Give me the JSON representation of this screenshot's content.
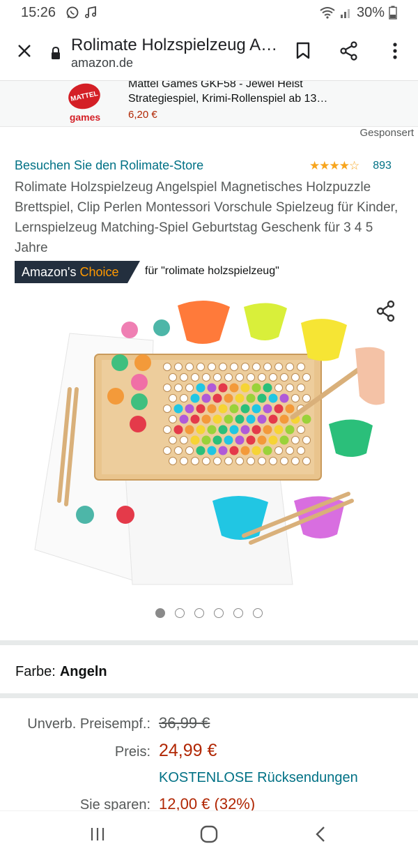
{
  "status_bar": {
    "time": "15:26",
    "battery": "30%",
    "icons": [
      "whatsapp-icon",
      "music-note-icon",
      "wifi-icon",
      "signal-icon",
      "battery-icon"
    ]
  },
  "browser": {
    "title": "Rolimate Holzspielzeug Angelspiel Magnetisches Holzpuzzle",
    "url": "amazon.de",
    "icons": [
      "close-icon",
      "lock-icon",
      "bookmark-icon",
      "share-icon",
      "more-vert-icon"
    ]
  },
  "sponsored_ad": {
    "logo_top": "MATTEL",
    "logo_bottom": "games",
    "line1": "Mattel Games GKF58 - Jewel Heist",
    "line2": "Strategiespiel, Krimi-Rollenspiel ab 13…",
    "price": "6,20 €",
    "sponsored_label": "Gesponsert"
  },
  "product": {
    "store_link": "Besuchen Sie den Rolimate-Store",
    "rating": 4.5,
    "rating_count": "893",
    "title": "Rolimate Holzspielzeug Angelspiel Magnetisches Holzpuzzle Brettspiel, Clip Perlen Montessori Vorschule Spielzeug für Kinder, Lernspielzeug Matching-Spiel Geburtstag Geschenk für 3 4 5 Jahre",
    "choice_badge_prefix": "Amazon's",
    "choice_badge_word": "Choice",
    "choice_for": "für \"rolimate holzspielzeug\"",
    "image_count": 6,
    "image_active_index": 0
  },
  "variation": {
    "label": "Farbe:",
    "value": "Angeln"
  },
  "pricing": {
    "list_price_label": "Unverb. Preisempf.:",
    "list_price": "36,99 €",
    "price_label": "Preis:",
    "price": "24,99 €",
    "returns_link": "KOSTENLOSE Rücksendungen",
    "savings_label": "Sie sparen:",
    "savings": "12,00 € (32%)"
  },
  "navbar": {
    "icons": [
      "recent-apps-icon",
      "home-icon",
      "back-icon"
    ]
  },
  "colors": {
    "link": "#007185",
    "price": "#b12704",
    "choice_bg": "#232f3e",
    "choice_accent": "#ff9900",
    "star": "#f7a51e"
  }
}
